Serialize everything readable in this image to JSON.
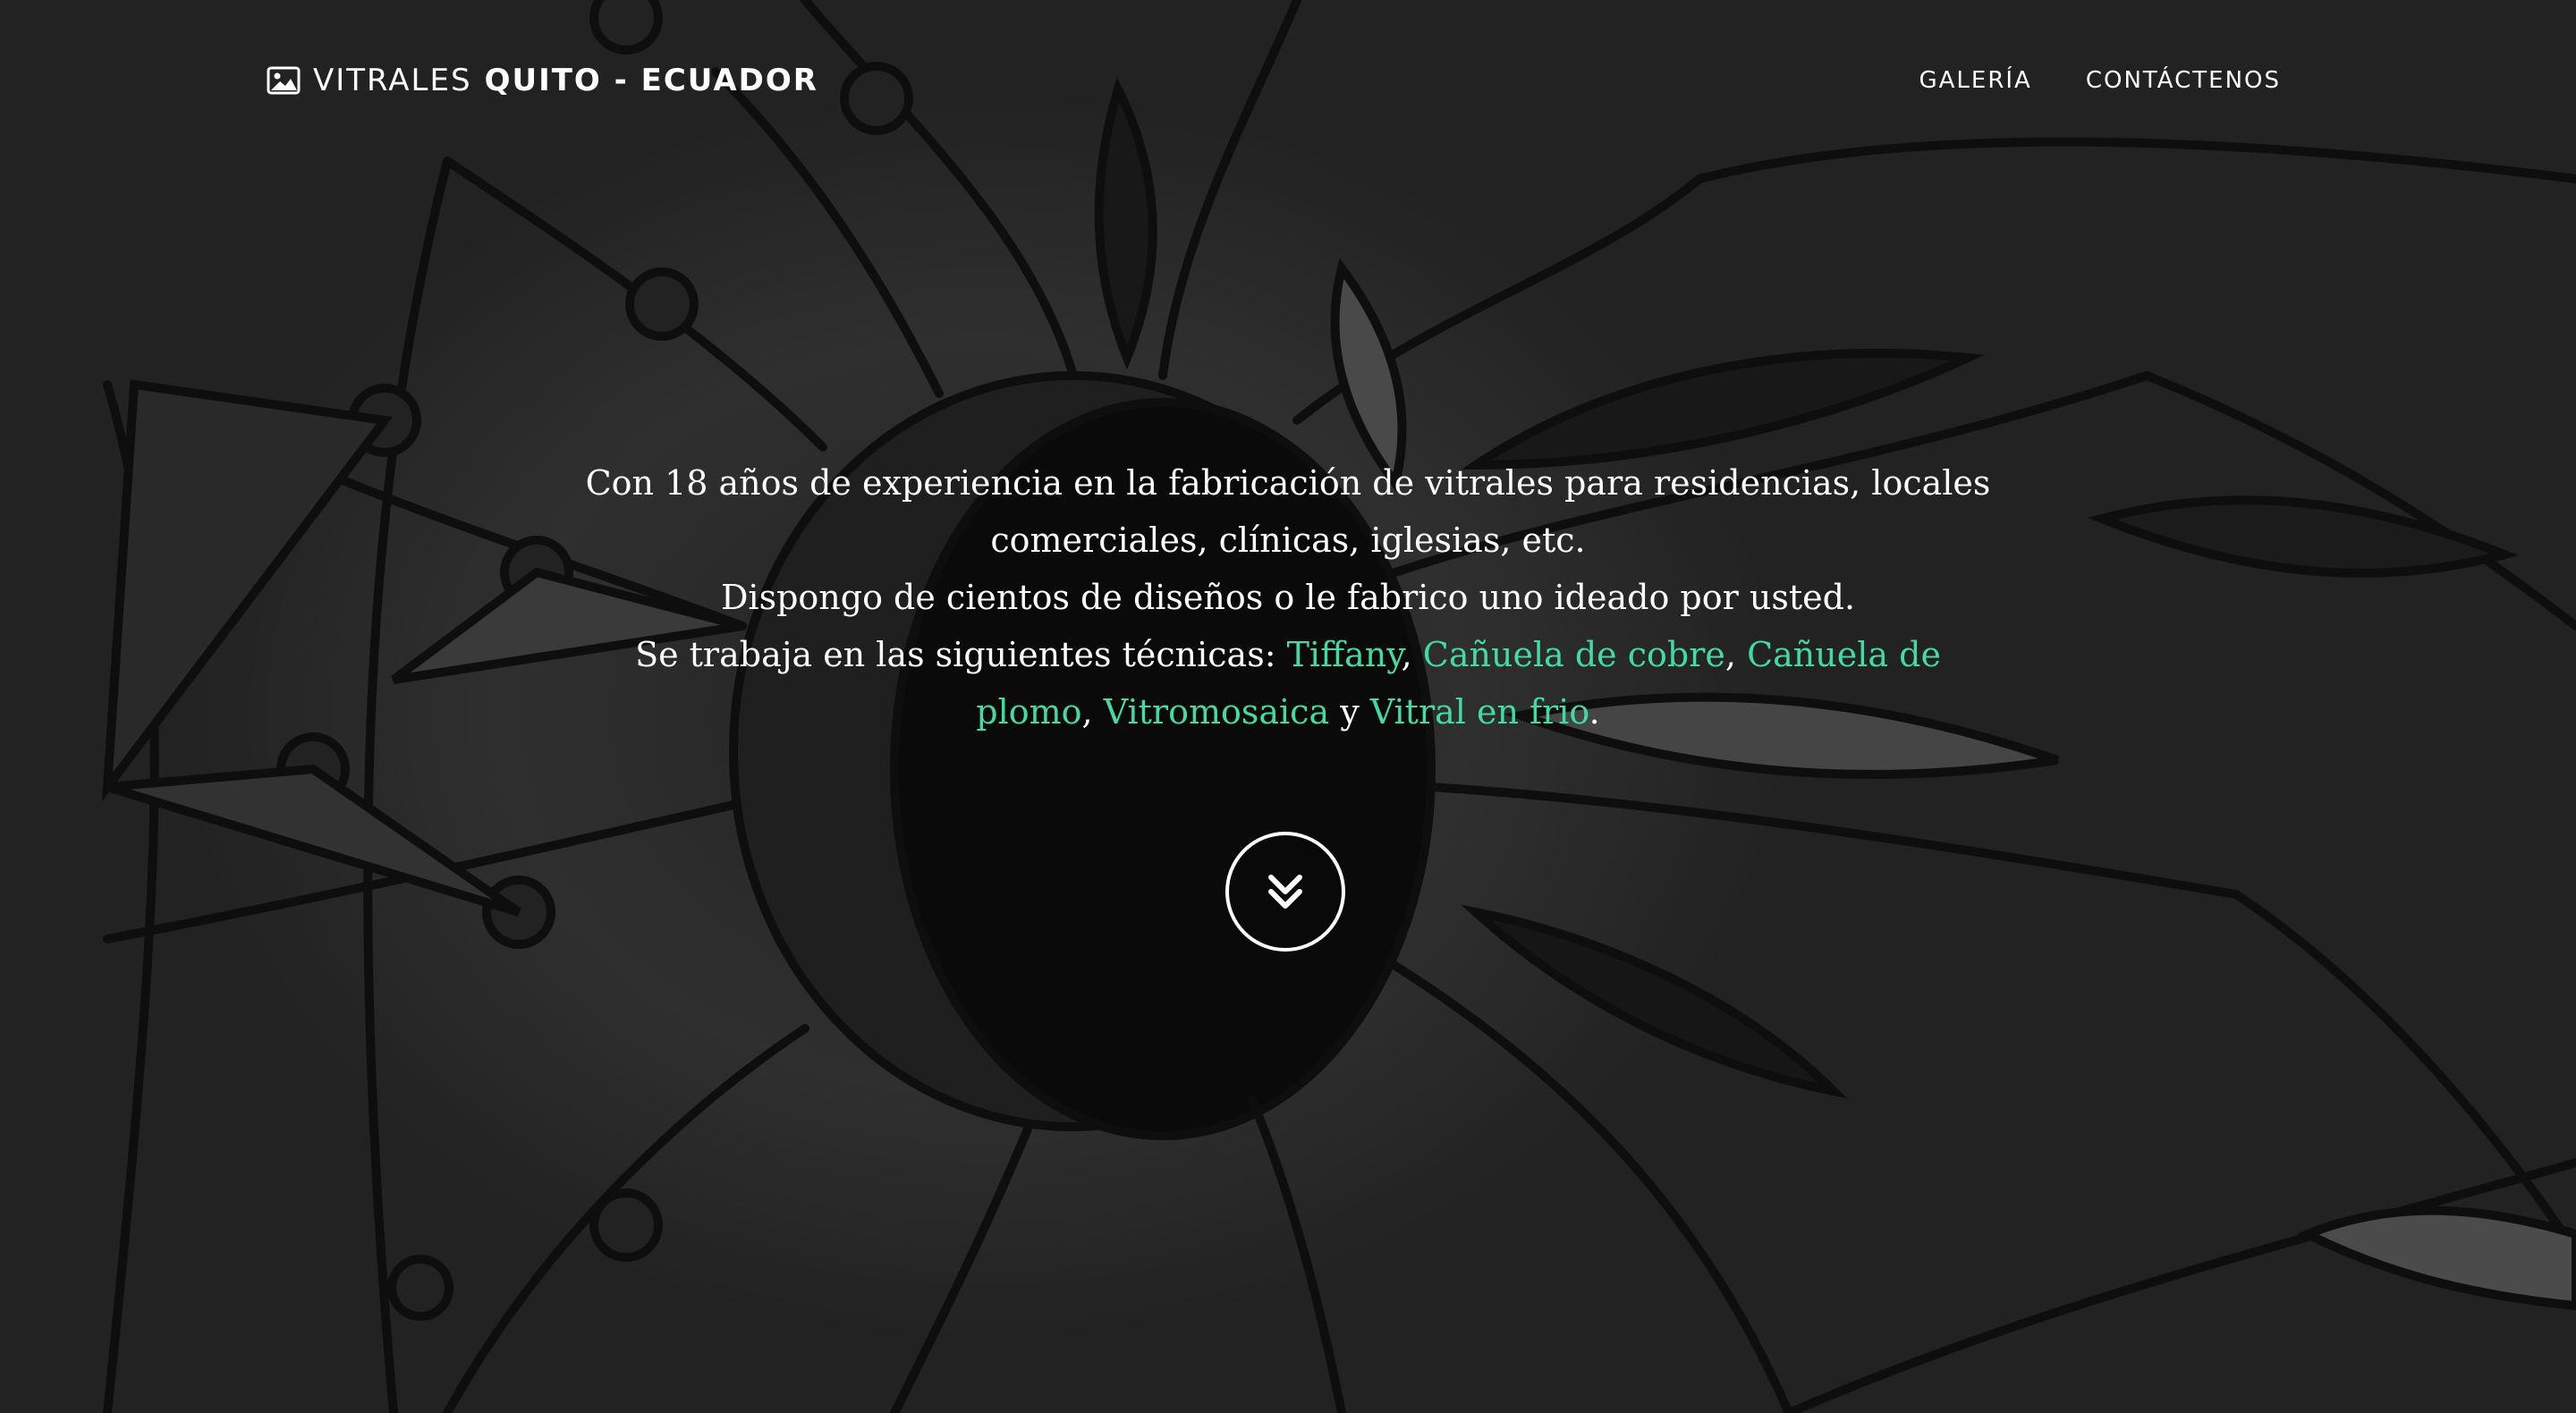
{
  "brand": {
    "icon": "image-icon",
    "light": "VITRALES",
    "bold": "QUITO - ECUADOR"
  },
  "nav": {
    "items": [
      {
        "label": "GALERÍA"
      },
      {
        "label": "CONTÁCTENOS"
      }
    ]
  },
  "intro": {
    "line1": "Con 18 años de experiencia en la fabricación de vitrales para residencias, locales comerciales, clínicas, iglesias, etc.",
    "line2": "Dispongo de cientos de diseños o le fabrico uno ideado por usted.",
    "line3_prefix": "Se trabaja en las siguientes técnicas: ",
    "techniques": [
      "Tiffany",
      "Cañuela de cobre",
      "Cañuela de plomo",
      "Vitromosaica",
      "Vitral en frio"
    ],
    "sep_comma": ", ",
    "sep_and": " y ",
    "end": "."
  },
  "scroll_button": {
    "icon": "double-chevron-down-icon"
  },
  "colors": {
    "accent": "#42dca3",
    "text": "#ffffff"
  }
}
